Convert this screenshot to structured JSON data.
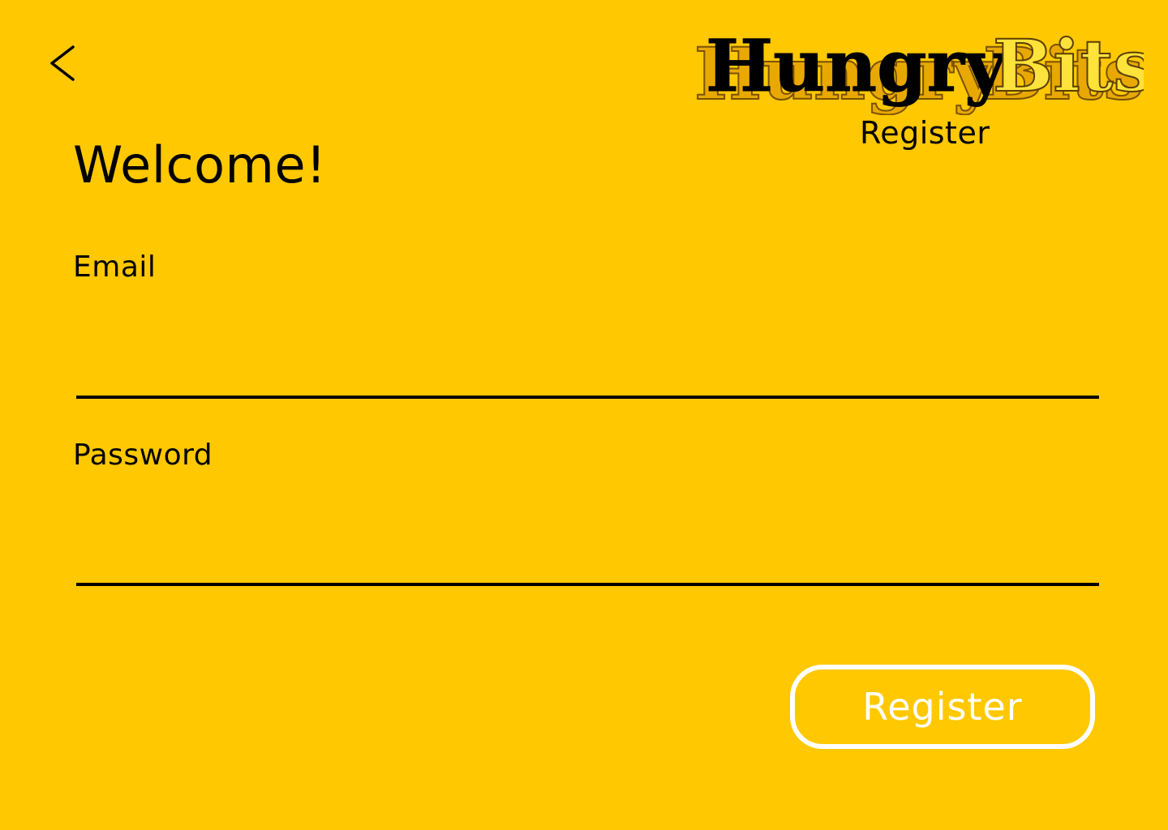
{
  "header": {
    "back_icon": "chevron-left-icon",
    "logo": {
      "part1": "Hungry",
      "part2": "Bits",
      "part1_color": "#000000",
      "part2_color": "#FFE23A",
      "shadow_color": "#E8A800"
    },
    "subtitle": "Register"
  },
  "main": {
    "title": "Welcome!",
    "email": {
      "label": "Email",
      "value": "",
      "placeholder": ""
    },
    "password": {
      "label": "Password",
      "value": "",
      "placeholder": ""
    },
    "submit_label": "Register"
  },
  "colors": {
    "background": "#FFC800",
    "text": "#000000",
    "button_outline": "#FFFFFF"
  }
}
